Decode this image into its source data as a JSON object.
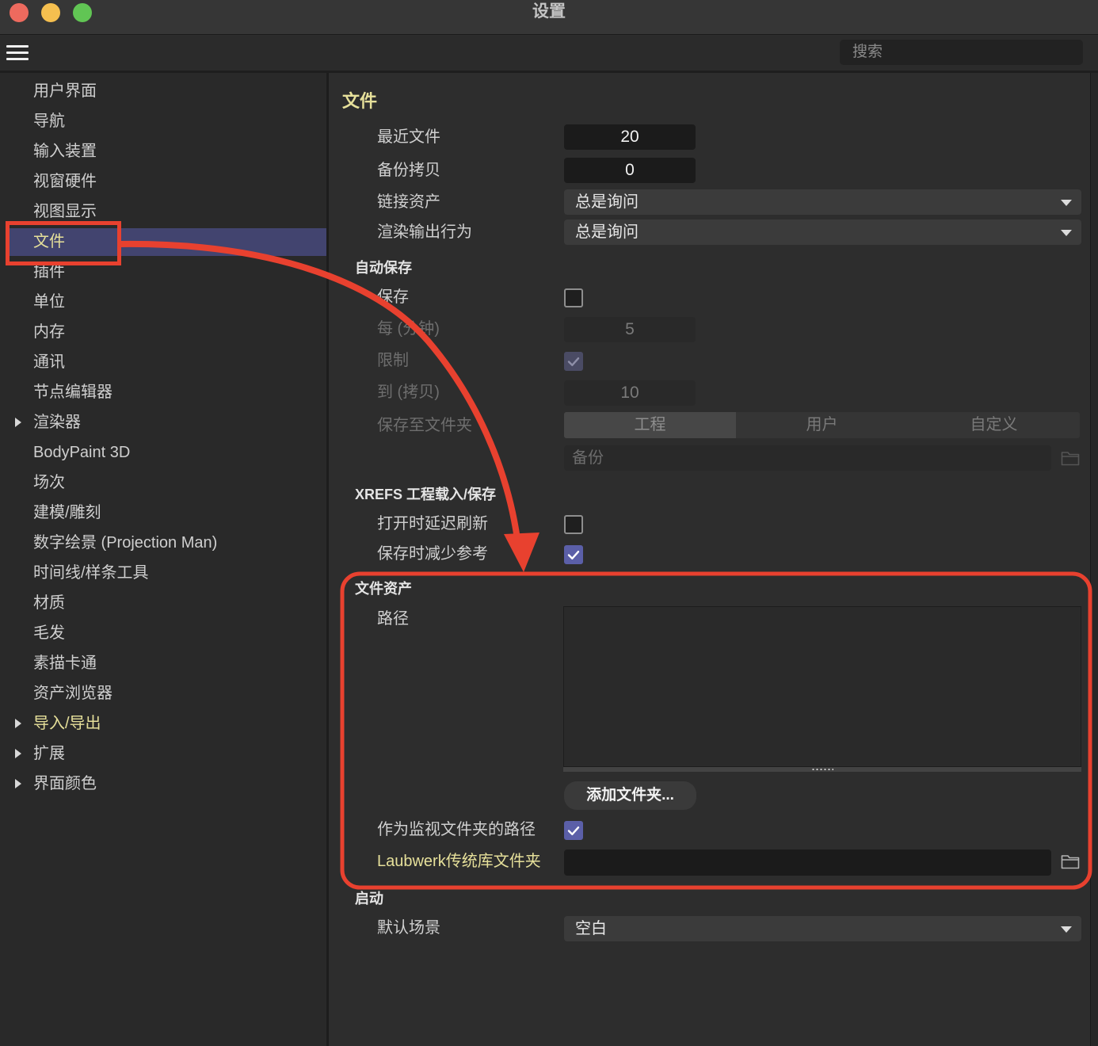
{
  "window": {
    "title": "设置"
  },
  "toolbar": {
    "search_placeholder": "搜索"
  },
  "sidebar": {
    "items": [
      {
        "label": "用户界面"
      },
      {
        "label": "导航"
      },
      {
        "label": "输入装置"
      },
      {
        "label": "视窗硬件"
      },
      {
        "label": "视图显示"
      },
      {
        "label": "文件",
        "selected": true
      },
      {
        "label": "插件"
      },
      {
        "label": "单位"
      },
      {
        "label": "内存"
      },
      {
        "label": "通讯"
      },
      {
        "label": "节点编辑器"
      },
      {
        "label": "渲染器",
        "expandable": true
      },
      {
        "label": "BodyPaint 3D"
      },
      {
        "label": "场次"
      },
      {
        "label": "建模/雕刻"
      },
      {
        "label": "数字绘景 (Projection Man)"
      },
      {
        "label": "时间线/样条工具"
      },
      {
        "label": "材质"
      },
      {
        "label": "毛发"
      },
      {
        "label": "素描卡通"
      },
      {
        "label": "资产浏览器"
      },
      {
        "label": "导入/导出",
        "expandable": true,
        "highlight": true
      },
      {
        "label": "扩展",
        "expandable": true
      },
      {
        "label": "界面颜色",
        "expandable": true
      }
    ]
  },
  "main": {
    "file": {
      "title": "文件",
      "recent_files": {
        "label": "最近文件",
        "value": "20"
      },
      "backup_copies": {
        "label": "备份拷贝",
        "value": "0"
      },
      "link_assets": {
        "label": "链接资产",
        "value": "总是询问"
      },
      "render_output": {
        "label": "渲染输出行为",
        "value": "总是询问"
      }
    },
    "autosave": {
      "title": "自动保存",
      "save": {
        "label": "保存",
        "checked": false
      },
      "interval": {
        "label": "每 (分钟)",
        "value": "5"
      },
      "limit": {
        "label": "限制",
        "checked": true
      },
      "max_copies": {
        "label": "到 (拷贝)",
        "value": "10"
      },
      "save_to_folder": {
        "label": "保存至文件夹",
        "options": [
          "工程",
          "用户",
          "自定义"
        ],
        "selected_index": 0
      },
      "backup_folder_placeholder": "备份"
    },
    "xrefs": {
      "title": "XREFS 工程载入/保存",
      "delay_refresh_on_open": {
        "label": "打开时延迟刷新",
        "checked": false
      },
      "reduce_refs_on_save": {
        "label": "保存时减少参考",
        "checked": true
      }
    },
    "file_assets": {
      "title": "文件资产",
      "paths": {
        "label": "路径"
      },
      "add_folder_button": "添加文件夹...",
      "watch_folders": {
        "label": "作为监视文件夹的路径",
        "checked": true
      },
      "laubwerk_folder": {
        "label": "Laubwerk传统库文件夹",
        "value": ""
      }
    },
    "startup": {
      "title": "启动",
      "default_scene": {
        "label": "默认场景",
        "value": "空白"
      }
    }
  },
  "icons": {
    "menu": "hamburger-menu-icon",
    "expand": "triangle-right-icon",
    "dropdown": "chevron-down-icon",
    "check": "checkmark-icon",
    "folder": "folder-icon"
  },
  "colors": {
    "selection_bg": "#42446f",
    "accent_check": "#5b5fa8",
    "highlight_text": "#e6e09a",
    "annotation_red": "#e8412f",
    "traffic_close": "#ed6a5e",
    "traffic_minimize": "#f5bf4f",
    "traffic_zoom": "#61c554"
  }
}
